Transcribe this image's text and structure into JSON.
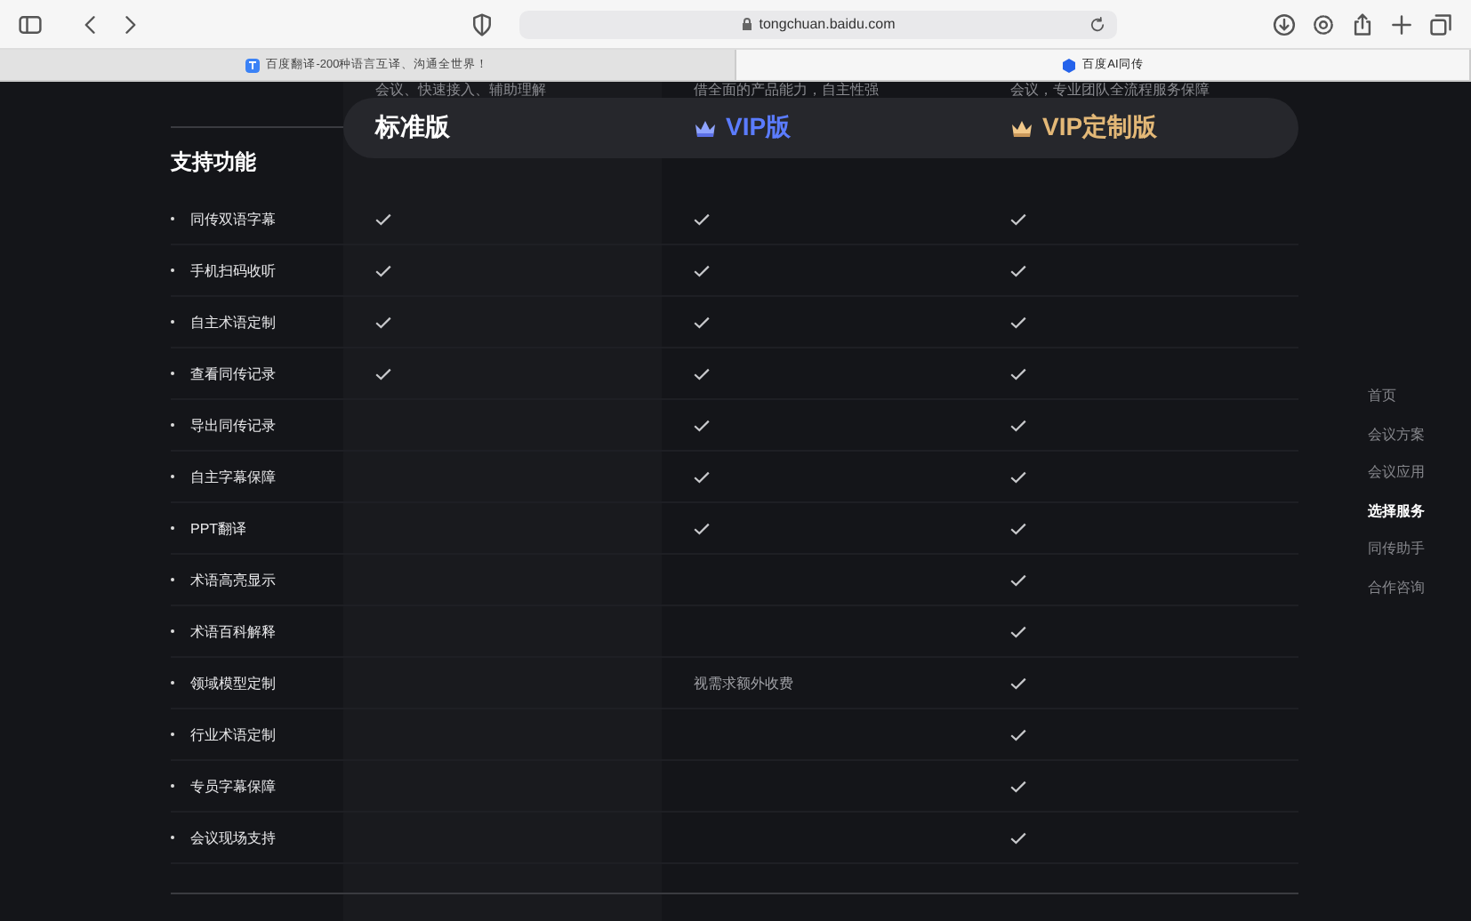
{
  "browser": {
    "url": "tongchuan.baidu.com",
    "tabs": [
      {
        "title": "百度翻译-200种语言互译、沟通全世界！",
        "selected": false
      },
      {
        "title": "百度AI同传",
        "selected": true
      }
    ]
  },
  "plans": [
    {
      "kind": "standard",
      "name": "标准版",
      "subtitle": "会议、快速接入、辅助理解"
    },
    {
      "kind": "vip",
      "name": "VIP版",
      "subtitle": "借全面的产品能力，自主性强"
    },
    {
      "kind": "custom",
      "name": "VIP定制版",
      "subtitle": "会议，专业团队全流程服务保障"
    }
  ],
  "features_title": "支持功能",
  "features": [
    {
      "name": "同传双语字幕",
      "cells": [
        {
          "kind": "check"
        },
        {
          "kind": "check"
        },
        {
          "kind": "check"
        }
      ]
    },
    {
      "name": "手机扫码收听",
      "cells": [
        {
          "kind": "check"
        },
        {
          "kind": "check"
        },
        {
          "kind": "check"
        }
      ]
    },
    {
      "name": "自主术语定制",
      "cells": [
        {
          "kind": "check"
        },
        {
          "kind": "check"
        },
        {
          "kind": "check"
        }
      ]
    },
    {
      "name": "查看同传记录",
      "cells": [
        {
          "kind": "check"
        },
        {
          "kind": "check"
        },
        {
          "kind": "check"
        }
      ]
    },
    {
      "name": "导出同传记录",
      "cells": [
        {
          "kind": "none"
        },
        {
          "kind": "check"
        },
        {
          "kind": "check"
        }
      ]
    },
    {
      "name": "自主字幕保障",
      "cells": [
        {
          "kind": "none"
        },
        {
          "kind": "check"
        },
        {
          "kind": "check"
        }
      ]
    },
    {
      "name": "PPT翻译",
      "cells": [
        {
          "kind": "none"
        },
        {
          "kind": "check"
        },
        {
          "kind": "check"
        }
      ]
    },
    {
      "name": "术语高亮显示",
      "cells": [
        {
          "kind": "none"
        },
        {
          "kind": "none"
        },
        {
          "kind": "check"
        }
      ]
    },
    {
      "name": "术语百科解释",
      "cells": [
        {
          "kind": "none"
        },
        {
          "kind": "none"
        },
        {
          "kind": "check"
        }
      ]
    },
    {
      "name": "领域模型定制",
      "cells": [
        {
          "kind": "none"
        },
        {
          "kind": "text",
          "text": "视需求额外收费"
        },
        {
          "kind": "check"
        }
      ]
    },
    {
      "name": "行业术语定制",
      "cells": [
        {
          "kind": "none"
        },
        {
          "kind": "none"
        },
        {
          "kind": "check"
        }
      ]
    },
    {
      "name": "专员字幕保障",
      "cells": [
        {
          "kind": "none"
        },
        {
          "kind": "none"
        },
        {
          "kind": "check"
        }
      ]
    },
    {
      "name": "会议现场支持",
      "cells": [
        {
          "kind": "none"
        },
        {
          "kind": "none"
        },
        {
          "kind": "check"
        }
      ]
    }
  ],
  "side_nav": [
    {
      "label": "首页",
      "selected": false
    },
    {
      "label": "会议方案",
      "selected": false
    },
    {
      "label": "会议应用",
      "selected": false
    },
    {
      "label": "选择服务",
      "selected": true
    },
    {
      "label": "同传助手",
      "selected": false
    },
    {
      "label": "合作咨询",
      "selected": false
    }
  ]
}
